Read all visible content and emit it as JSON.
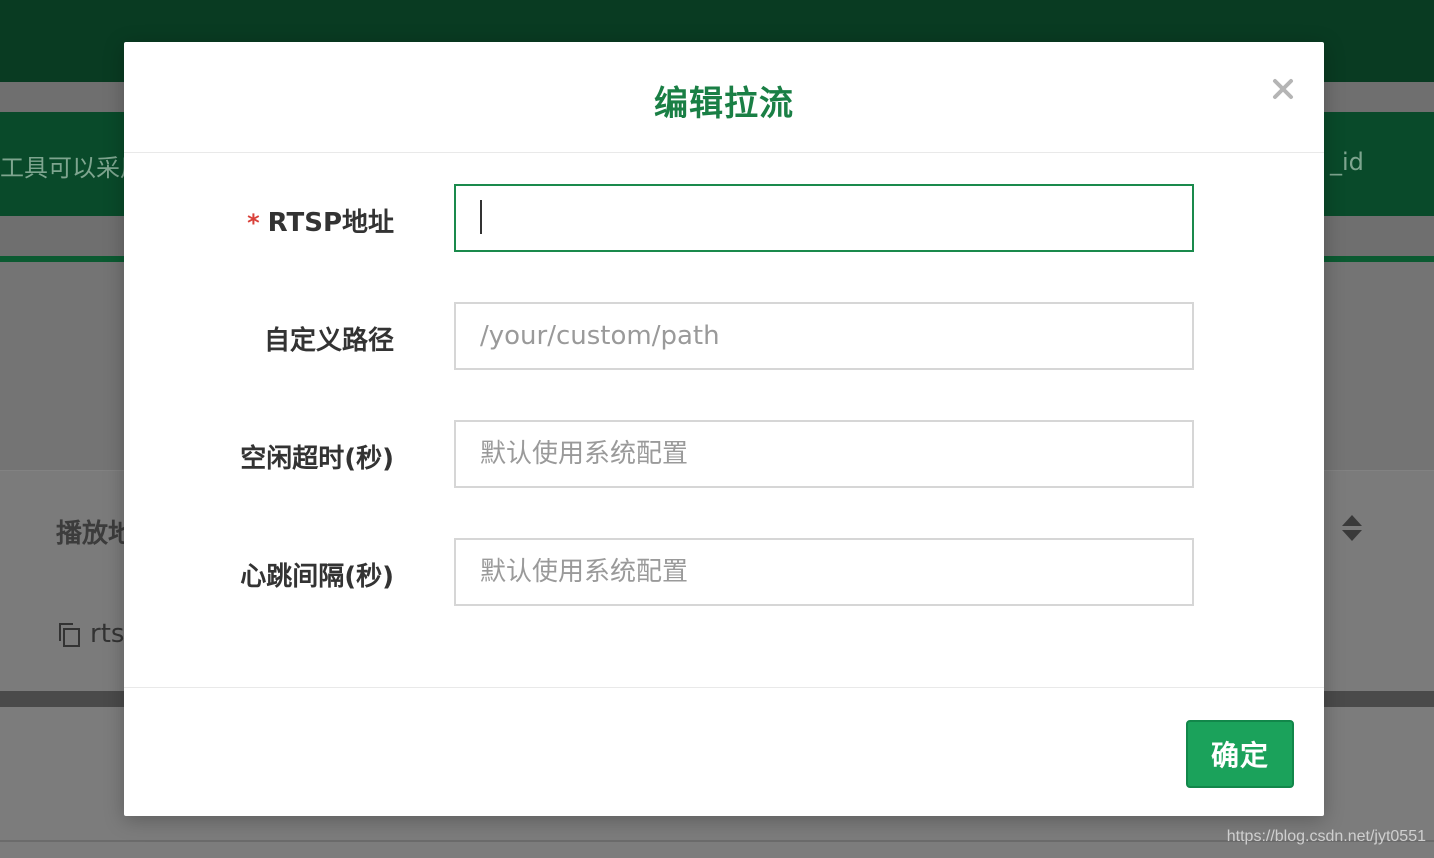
{
  "background": {
    "banner_left_text": "工具可以采用",
    "banner_right_text": "_id",
    "table_header_label": "播放地",
    "table_row_text": "rts"
  },
  "modal": {
    "title": "编辑拉流",
    "close_glyph": "×",
    "fields": [
      {
        "required_mark": "*",
        "label": "RTSP地址",
        "value": "",
        "placeholder": "",
        "focused": true
      },
      {
        "label": "自定义路径",
        "value": "",
        "placeholder": "/your/custom/path"
      },
      {
        "label": "空闲超时(秒)",
        "value": "",
        "placeholder": "默认使用系统配置"
      },
      {
        "label": "心跳间隔(秒)",
        "value": "",
        "placeholder": "默认使用系统配置"
      }
    ],
    "confirm_label": "确定"
  },
  "watermark": "https://blog.csdn.net/jyt0551",
  "colors": {
    "accent": "#1a7f45",
    "button": "#1ba25b",
    "required": "#d9413a",
    "topbar": "#093b22"
  },
  "icons": {
    "close": "close-icon",
    "sort": "sort-icon",
    "copy": "copy-icon"
  }
}
